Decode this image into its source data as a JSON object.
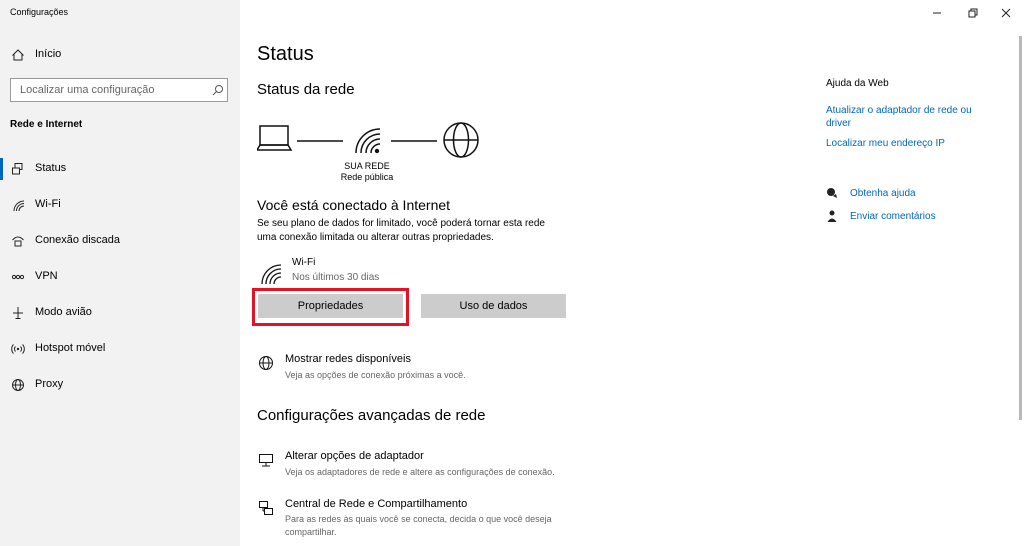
{
  "window": {
    "title": "Configurações"
  },
  "sidebar": {
    "home_label": "Início",
    "search_placeholder": "Localizar uma configuração",
    "section_title": "Rede e Internet",
    "items": [
      {
        "label": "Status"
      },
      {
        "label": "Wi-Fi"
      },
      {
        "label": "Conexão discada"
      },
      {
        "label": "VPN"
      },
      {
        "label": "Modo avião"
      },
      {
        "label": "Hotspot móvel"
      },
      {
        "label": "Proxy"
      }
    ]
  },
  "main": {
    "title": "Status",
    "network_status_heading": "Status da rede",
    "network_name": "SUA REDE",
    "network_type": "Rede pública",
    "connected_heading": "Você está conectado à Internet",
    "connected_desc_line1": "Se seu plano de dados for limitado, você poderá tornar esta rede",
    "connected_desc_line2": "uma conexão limitada ou alterar outras propriedades.",
    "connection_name": "Wi-Fi",
    "connection_usage": "Nos últimos 30 dias",
    "properties_button": "Propriedades",
    "data_usage_button": "Uso de dados",
    "show_networks_title": "Mostrar redes disponíveis",
    "show_networks_desc": "Veja as opções de conexão próximas a você.",
    "advanced_heading": "Configurações avançadas de rede",
    "adapter_title": "Alterar opções de adaptador",
    "adapter_desc": "Veja os adaptadores de rede e altere as configurações de conexão.",
    "center_title": "Central de Rede e Compartilhamento",
    "center_desc_line1": "Para as redes às quais você se conecta, decida o que você deseja",
    "center_desc_line2": "compartilhar."
  },
  "help": {
    "heading": "Ajuda da Web",
    "links": [
      "Atualizar o adaptador de rede ou",
      "driver",
      "Localizar meu endereço IP"
    ],
    "get_help": "Obtenha ajuda",
    "feedback": "Enviar comentários"
  },
  "colors": {
    "accent": "#0067c0",
    "highlight_border": "#e81123",
    "sidebar_bg": "#f2f2f2",
    "button_bg": "#cccccc"
  }
}
